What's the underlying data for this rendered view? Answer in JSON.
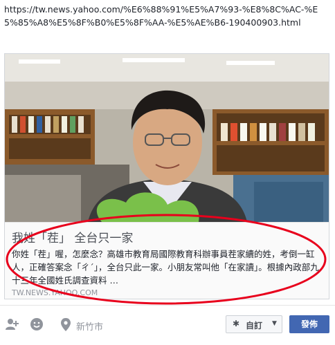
{
  "share_url": "https://tw.news.yahoo.com/%E6%88%91%E5%A7%93-%E8%8C%AC-%E5%85%A8%E5%8F%B0%E5%8F%AA-%E5%AE%B6-190400903.html",
  "link_card": {
    "title": "我姓「茬」 全台只一家",
    "description": "你姓「茬」喔，怎麼念？高雄市教育局國際教育科辦事員茬家續的姓，考倒一缸人，正確答案念「ㄔˊ」，全台只此一家。小朋友常叫他「在家讀」。根據內政部九十三年全國姓氏調查資料 …",
    "source": "TW.NEWS.YAHOO.COM"
  },
  "composer": {
    "location": "新竹市",
    "privacy_label": "自訂",
    "post_label": "發佈",
    "icons": [
      "tag-friends-icon",
      "feeling-icon",
      "location-pin-icon",
      "gear-icon",
      "caret-down-icon"
    ],
    "colors": {
      "post_button": "#4267b2",
      "highlight_ellipse": "#e8001c"
    }
  }
}
